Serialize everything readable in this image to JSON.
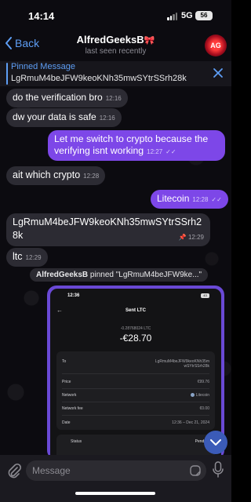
{
  "status_bar": {
    "time": "14:14",
    "network": "5G",
    "battery": "56"
  },
  "header": {
    "back_label": "Back",
    "title": "AlfredGeeksB",
    "title_emoji": "🎀",
    "subtitle": "last seen recently",
    "avatar_label": "AG"
  },
  "pinned": {
    "label": "Pinned Message",
    "text": "LgRmuM4beJFW9keoKNh35mwSYtrSSrh28k"
  },
  "messages": [
    {
      "dir": "in",
      "text": "do the verification bro",
      "time": "12:16"
    },
    {
      "dir": "in",
      "text": "dw your data is safe",
      "time": "12:16"
    },
    {
      "dir": "out",
      "text": "Let me switch to crypto because the verifying isnt working",
      "time": "12:27"
    },
    {
      "dir": "in",
      "text": "ait which crypto",
      "time": "12:28"
    },
    {
      "dir": "out",
      "text": "Litecoin",
      "time": "12:28"
    },
    {
      "dir": "in",
      "text": "LgRmuM4beJFW9keoKNh35mwSYtrSSrh28k",
      "time": "12:29"
    },
    {
      "dir": "in",
      "text": "ltc",
      "time": "12:29"
    }
  ],
  "service_message": {
    "actor": "AlfredGeeksB",
    "text": "pinned \"LgRmuM4beJFW9ke...\""
  },
  "photo": {
    "time": "12:36",
    "battery": "43",
    "title": "Sent LTC",
    "amount": "-0.28768024 LTC",
    "fiat": "-€28.70",
    "rows": [
      {
        "key": "To",
        "value": "LgRmuM4beJFW9keoKNh35mwSYtrSSrh28k"
      },
      {
        "key": "Price",
        "value": "€99.76"
      },
      {
        "key": "Network",
        "value": "Litecoin"
      },
      {
        "key": "Network fee",
        "value": "€0.00"
      },
      {
        "key": "Date",
        "value": "12:36 – Dec 21, 2024"
      }
    ],
    "status_key": "Status",
    "status_value": "Pending"
  },
  "composer": {
    "placeholder": "Message"
  },
  "colors": {
    "accent": "#5e9ef5",
    "outgoing": "#7d47e8",
    "incoming": "#2c2b33"
  }
}
